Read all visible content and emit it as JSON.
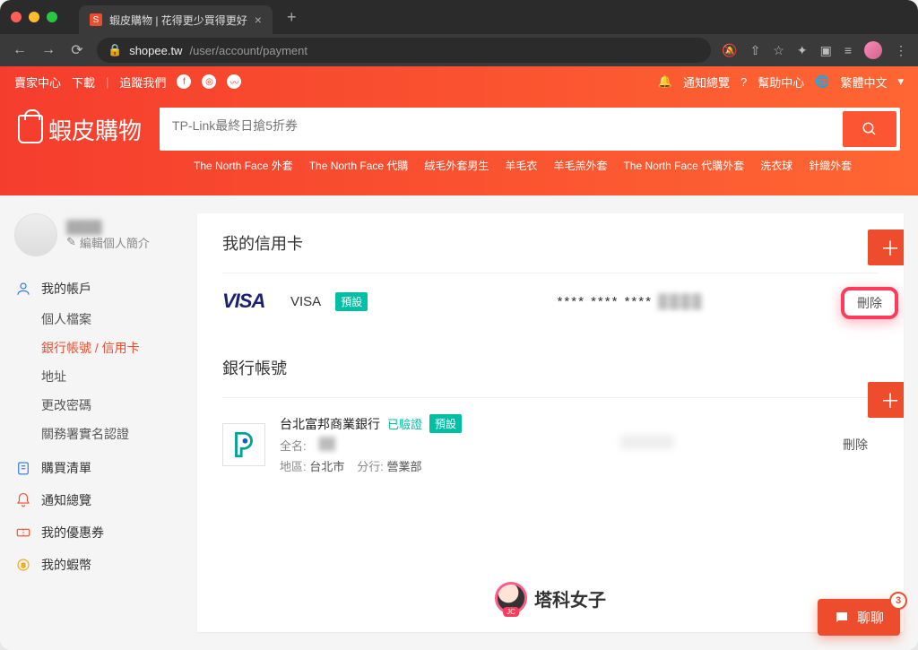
{
  "browser": {
    "tab_title": "蝦皮購物 | 花得更少買得更好",
    "url_domain": "shopee.tw",
    "url_path": "/user/account/payment"
  },
  "topbar": {
    "seller_center": "賣家中心",
    "download": "下載",
    "follow": "追蹤我們",
    "notifications": "通知總覽",
    "help": "幫助中心",
    "language": "繁體中文"
  },
  "header": {
    "logo_text": "蝦皮購物",
    "search_placeholder": "TP-Link最終日搶5折券",
    "suggestions": [
      "The North Face 外套",
      "The North Face 代購",
      "絨毛外套男生",
      "羊毛衣",
      "羊毛羔外套",
      "The North Face 代購外套",
      "洗衣球",
      "針織外套"
    ]
  },
  "sidebar": {
    "edit_profile": "編輯個人簡介",
    "account": {
      "label": "我的帳戶",
      "items": [
        "個人檔案",
        "銀行帳號 / 信用卡",
        "地址",
        "更改密碼",
        "關務署實名認證"
      ],
      "active_index": 1
    },
    "purchase": "購買清單",
    "notifications": "通知總覽",
    "coupons": "我的優惠券",
    "coins": "我的蝦幣"
  },
  "main": {
    "credit_cards": {
      "title": "我的信用卡",
      "row": {
        "brand": "VISA",
        "type_label": "VISA",
        "default_badge": "預設",
        "masked": "**** **** ****",
        "delete_label": "刪除"
      }
    },
    "bank": {
      "title": "銀行帳號",
      "row": {
        "bank_name": "台北富邦商業銀行",
        "verified": "已驗證",
        "default_badge": "預設",
        "fullname_label": "全名:",
        "region_label": "地區:",
        "region_value": "台北市",
        "branch_label": "分行:",
        "branch_value": "營業部",
        "delete_label": "刪除"
      }
    }
  },
  "overlay": {
    "text": "塔科女子"
  },
  "chat": {
    "label": "聊聊",
    "badge": "3"
  }
}
